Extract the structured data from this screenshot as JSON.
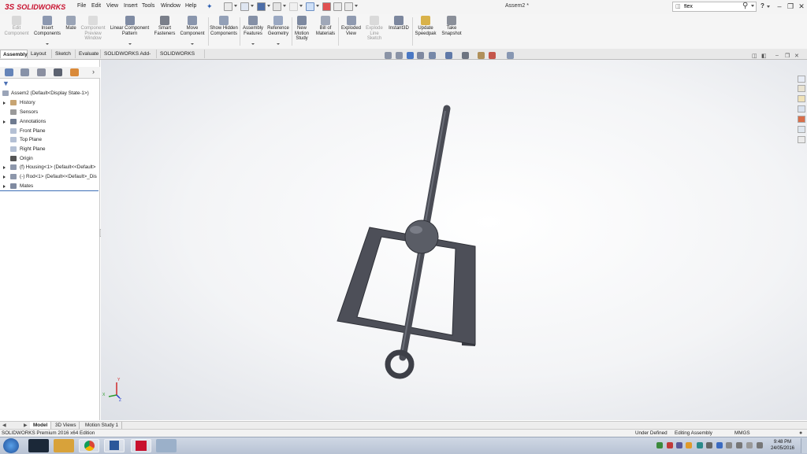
{
  "app": {
    "brand": "SOLIDWORKS",
    "document_title": "Assem2 *"
  },
  "menu": [
    "File",
    "Edit",
    "View",
    "Insert",
    "Tools",
    "Window",
    "Help"
  ],
  "search": {
    "value": "flex",
    "help_label": "?"
  },
  "commands": {
    "edit_component": "Edit Component",
    "insert_components": "Insert Components",
    "mate": "Mate",
    "component_preview_window": "Component Preview Window",
    "linear_component_pattern": "Linear Component Pattern",
    "smart_fasteners": "Smart Fasteners",
    "move_component": "Move Component",
    "show_hidden_components": "Show Hidden Components",
    "assembly_features": "Assembly Features",
    "reference_geometry": "Reference Geometry",
    "new_motion_study": "New Motion Study",
    "bill_of_materials": "Bill of Materials",
    "exploded_view": "Exploded View",
    "explode_line_sketch": "Explode Line Sketch",
    "instant3d": "Instant3D",
    "update_speedpak": "Update Speedpak",
    "take_snapshot": "Take Snapshot"
  },
  "tabs": [
    "Assembly",
    "Layout",
    "Sketch",
    "Evaluate",
    "SOLIDWORKS Add-Ins",
    "SOLIDWORKS MBD"
  ],
  "tree": {
    "root": "Assem2  (Default<Display State-1>)",
    "items": [
      {
        "label": "History",
        "expandable": true
      },
      {
        "label": "Sensors",
        "expandable": false
      },
      {
        "label": "Annotations",
        "expandable": true
      },
      {
        "label": "Front Plane",
        "expandable": false
      },
      {
        "label": "Top Plane",
        "expandable": false
      },
      {
        "label": "Right Plane",
        "expandable": false
      },
      {
        "label": "Origin",
        "expandable": false
      },
      {
        "label": "(f) Housing<1> (Default<<Default>",
        "expandable": true
      },
      {
        "label": "(-) Rod<1> (Default<<Default>_Dis",
        "expandable": true
      },
      {
        "label": "Mates",
        "expandable": true
      }
    ]
  },
  "bottom_tabs": [
    "Model",
    "3D Views",
    "Motion Study 1"
  ],
  "status": {
    "product": "SOLIDWORKS Premium 2016 x64 Edition",
    "state": "Under Defined",
    "mode": "Editing Assembly",
    "units": "MMGS"
  },
  "taskbar": {
    "time": "9:48 PM",
    "date": "24/05/2016"
  },
  "colors": {
    "brand_red": "#c8102e",
    "model_gray": "#4d4f58",
    "tree_selected_line": "#3d6fb6"
  },
  "triad": {
    "x": "X",
    "y": "Y",
    "z": "Z"
  }
}
